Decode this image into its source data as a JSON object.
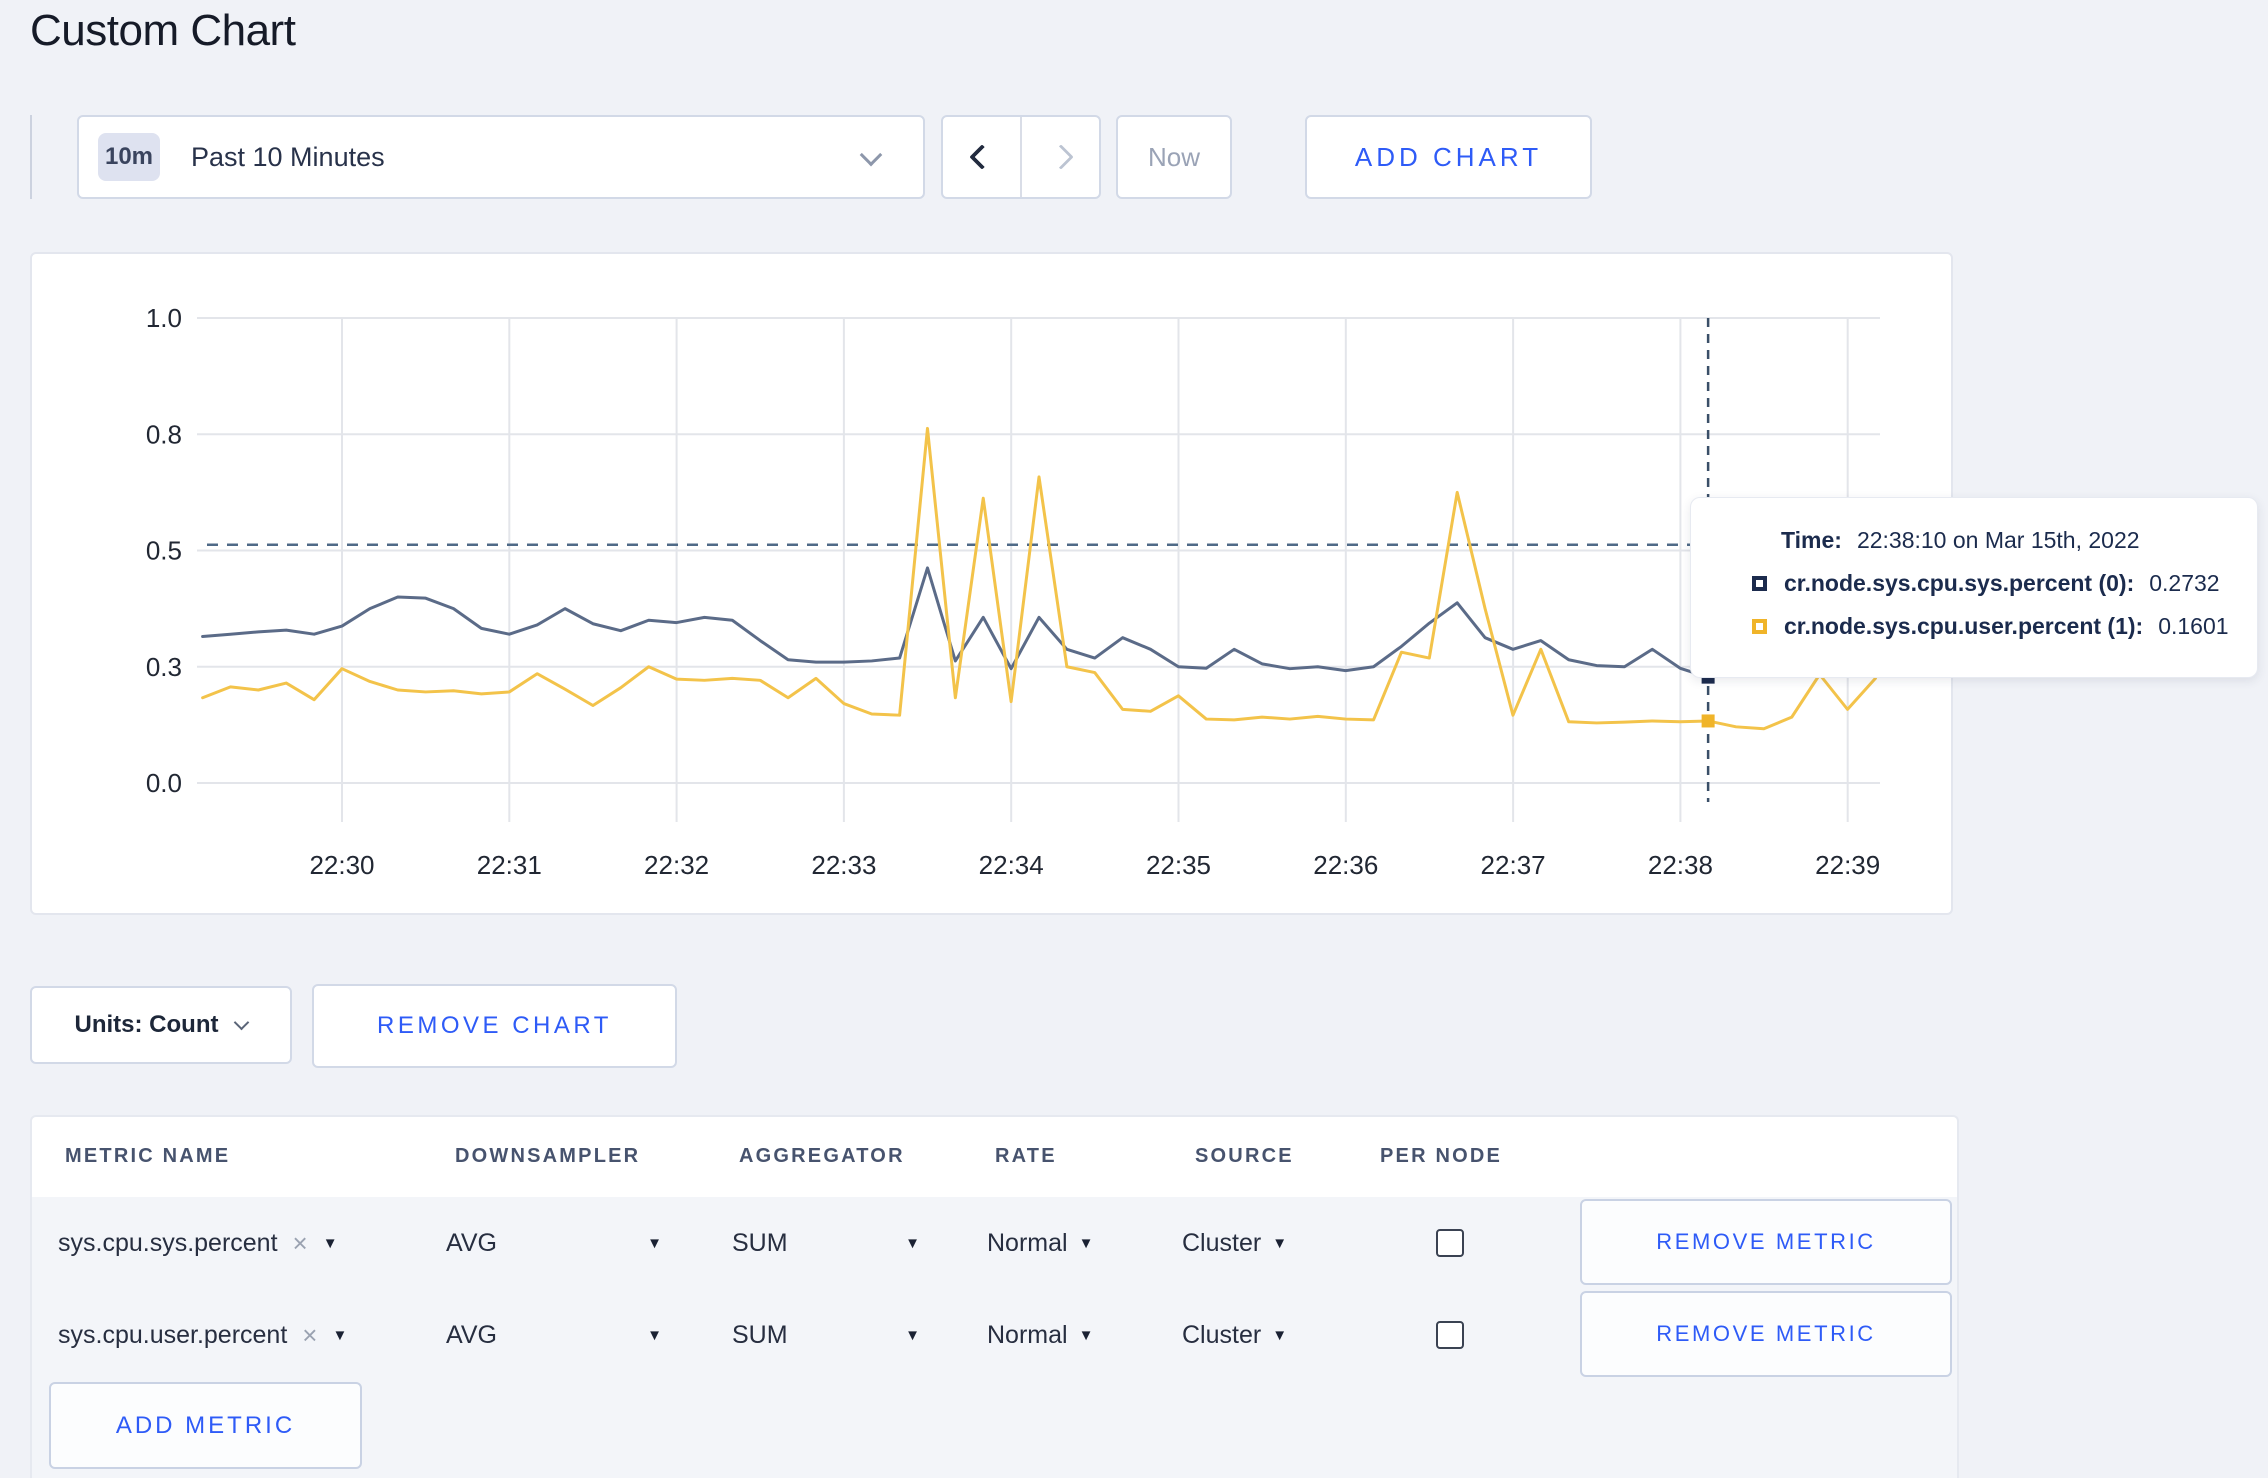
{
  "page": {
    "title": "Custom Chart"
  },
  "toolbar": {
    "time_window_badge": "10m",
    "time_window_label": "Past 10 Minutes",
    "prev_icon": "chevron-left",
    "next_icon": "chevron-right",
    "now_label": "Now",
    "add_chart_label": "ADD CHART"
  },
  "chart_data": {
    "type": "line",
    "title": "",
    "x_axis": {
      "start_time": "22:29:10",
      "interval_seconds": 10,
      "tick_labels": [
        "22:30",
        "22:31",
        "22:32",
        "22:33",
        "22:34",
        "22:35",
        "22:36",
        "22:37",
        "22:38",
        "22:39"
      ]
    },
    "y_axis": {
      "tick_labels": [
        "0.0",
        "0.3",
        "0.5",
        "0.8",
        "1.0"
      ],
      "tick_values": [
        0,
        0.3,
        0.5,
        0.8,
        1.0
      ]
    },
    "grid": true,
    "threshold_line": {
      "value": 0.515,
      "style": "dashed"
    },
    "cursor": {
      "index": 54,
      "time": "22:38:10"
    },
    "legend_position": "tooltip",
    "series": [
      {
        "name": "cr.node.sys.cpu.sys.percent (0)",
        "color": "#5b6b88",
        "swatch": "#1c2b4d",
        "values": [
          0.352,
          0.356,
          0.36,
          0.363,
          0.356,
          0.37,
          0.4,
          0.42,
          0.418,
          0.4,
          0.366,
          0.356,
          0.372,
          0.4,
          0.374,
          0.362,
          0.38,
          0.376,
          0.385,
          0.38,
          0.345,
          0.312,
          0.308,
          0.308,
          0.31,
          0.315,
          0.47,
          0.31,
          0.385,
          0.295,
          0.385,
          0.33,
          0.315,
          0.35,
          0.33,
          0.3,
          0.296,
          0.33,
          0.305,
          0.295,
          0.3,
          0.29,
          0.3,
          0.335,
          0.375,
          0.41,
          0.35,
          0.33,
          0.345,
          0.312,
          0.302,
          0.3,
          0.33,
          0.296,
          0.2732,
          0.29,
          0.325,
          0.31,
          0.3,
          0.298,
          0.315
        ]
      },
      {
        "name": "cr.node.sys.cpu.user.percent (1)",
        "color": "#f3c34a",
        "swatch": "#f0b429",
        "values": [
          0.22,
          0.248,
          0.24,
          0.258,
          0.215,
          0.295,
          0.262,
          0.24,
          0.235,
          0.238,
          0.23,
          0.235,
          0.282,
          0.242,
          0.2,
          0.246,
          0.3,
          0.268,
          0.265,
          0.27,
          0.265,
          0.22,
          0.27,
          0.205,
          0.178,
          0.175,
          0.81,
          0.22,
          0.635,
          0.21,
          0.69,
          0.3,
          0.285,
          0.19,
          0.185,
          0.225,
          0.165,
          0.163,
          0.17,
          0.165,
          0.172,
          0.165,
          0.163,
          0.325,
          0.315,
          0.65,
          0.4,
          0.175,
          0.33,
          0.158,
          0.155,
          0.157,
          0.16,
          0.158,
          0.1601,
          0.145,
          0.14,
          0.17,
          0.28,
          0.19,
          0.27
        ]
      }
    ]
  },
  "tooltip": {
    "time_label": "Time:",
    "time_value": "22:38:10 on Mar 15th, 2022",
    "rows": [
      {
        "name": "cr.node.sys.cpu.sys.percent (0):",
        "value": "0.2732"
      },
      {
        "name": "cr.node.sys.cpu.user.percent (1):",
        "value": "0.1601"
      }
    ]
  },
  "chart_footer": {
    "units_label": "Units: Count",
    "remove_chart_label": "REMOVE CHART"
  },
  "metrics_table": {
    "columns": [
      "METRIC NAME",
      "DOWNSAMPLER",
      "AGGREGATOR",
      "RATE",
      "SOURCE",
      "PER NODE"
    ],
    "rows": [
      {
        "name": "sys.cpu.sys.percent",
        "downsampler": "AVG",
        "aggregator": "SUM",
        "rate": "Normal",
        "source": "Cluster",
        "per_node_checked": false
      },
      {
        "name": "sys.cpu.user.percent",
        "downsampler": "AVG",
        "aggregator": "SUM",
        "rate": "Normal",
        "source": "Cluster",
        "per_node_checked": false
      }
    ],
    "remove_icon_glyph": "×",
    "caret_icon_glyph": "▼",
    "remove_metric_label": "REMOVE METRIC",
    "add_metric_label": "ADD METRIC"
  },
  "colors": {
    "accent_blue": "#2e5bf7",
    "sys_line": "#5b6b88",
    "user_line": "#f3c34a",
    "sys_swatch": "#1c2b4d",
    "user_swatch": "#f0b429",
    "dashed_guides": "#4f6a87",
    "page_background": "#f0f2f7"
  }
}
